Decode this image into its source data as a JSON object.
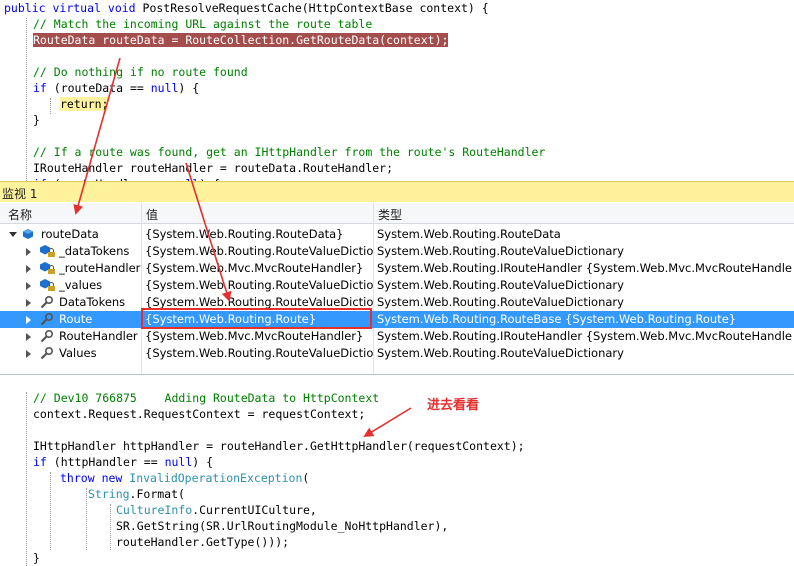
{
  "code_top": {
    "lines": [
      {
        "parts": [
          [
            "kw",
            "public"
          ],
          [
            "",
            " "
          ],
          [
            "kw",
            "virtual"
          ],
          [
            "",
            " "
          ],
          [
            "kw",
            "void"
          ],
          [
            "",
            " PostResolveRequestCache(HttpContextBase context) {"
          ]
        ]
      },
      {
        "parts": [
          [
            "cm",
            "// Match the incoming URL against the route table"
          ]
        ]
      },
      {
        "parts": [
          [
            "hl-red",
            "RouteData routeData = RouteCollection.GetRouteData(context);"
          ]
        ]
      },
      {
        "parts": [
          [
            "",
            ""
          ]
        ]
      },
      {
        "parts": [
          [
            "cm",
            "// Do nothing if no route found"
          ]
        ]
      },
      {
        "parts": [
          [
            "kw",
            "if"
          ],
          [
            "",
            " (routeData == "
          ],
          [
            "kw",
            "null"
          ],
          [
            "",
            ") {"
          ]
        ]
      },
      {
        "parts": [
          [
            "hl-yellow",
            "return;"
          ]
        ]
      },
      {
        "parts": [
          [
            "",
            "}"
          ]
        ]
      },
      {
        "parts": [
          [
            "",
            ""
          ]
        ]
      },
      {
        "parts": [
          [
            "cm",
            "// If a route was found, get an IHttpHandler from the route's RouteHandler"
          ]
        ]
      },
      {
        "parts": [
          [
            "",
            "IRouteHandler routeHandler = routeData.RouteHandler;"
          ]
        ]
      },
      {
        "parts": [
          [
            "kw",
            "if"
          ],
          [
            "",
            " (routeHandler == "
          ],
          [
            "kw",
            "null"
          ],
          [
            "",
            ") {"
          ]
        ]
      }
    ]
  },
  "watch": {
    "title": "监视 1",
    "headers": {
      "name": "名称",
      "value": "值",
      "type": "类型"
    },
    "rows": [
      {
        "name": "routeData",
        "value": "{System.Web.Routing.RouteData}",
        "type": "System.Web.Routing.RouteData",
        "icon": "object-icon",
        "expanded": true,
        "selected": false
      },
      {
        "name": "_dataTokens",
        "value": "{System.Web.Routing.RouteValueDictionary}",
        "type": "System.Web.Routing.RouteValueDictionary",
        "icon": "private-field-icon",
        "expanded": false,
        "selected": false
      },
      {
        "name": "_routeHandler",
        "value": "{System.Web.Mvc.MvcRouteHandler}",
        "type": "System.Web.Routing.IRouteHandler {System.Web.Mvc.MvcRouteHandler}",
        "icon": "private-field-icon",
        "expanded": false,
        "selected": false
      },
      {
        "name": "_values",
        "value": "{System.Web.Routing.RouteValueDictionary}",
        "type": "System.Web.Routing.RouteValueDictionary",
        "icon": "private-field-icon",
        "expanded": false,
        "selected": false
      },
      {
        "name": "DataTokens",
        "value": "{System.Web.Routing.RouteValueDictionary}",
        "type": "System.Web.Routing.RouteValueDictionary",
        "icon": "property-icon",
        "expanded": false,
        "selected": false
      },
      {
        "name": "Route",
        "value": "{System.Web.Routing.Route}",
        "type": "System.Web.Routing.RouteBase {System.Web.Routing.Route}",
        "icon": "property-icon",
        "expanded": false,
        "selected": true
      },
      {
        "name": "RouteHandler",
        "value": "{System.Web.Mvc.MvcRouteHandler}",
        "type": "System.Web.Routing.IRouteHandler {System.Web.Mvc.MvcRouteHandler}",
        "icon": "property-icon",
        "expanded": false,
        "selected": false
      },
      {
        "name": "Values",
        "value": "{System.Web.Routing.RouteValueDictionary}",
        "type": "System.Web.Routing.RouteValueDictionary",
        "icon": "property-icon",
        "expanded": false,
        "selected": false
      }
    ]
  },
  "code_bottom": {
    "lines": [
      {
        "parts": [
          [
            "cm",
            "// Dev10 766875    Adding RouteData to HttpContext"
          ]
        ]
      },
      {
        "parts": [
          [
            "",
            "context.Request.RequestContext = requestContext;"
          ]
        ]
      },
      {
        "parts": [
          [
            "",
            ""
          ]
        ]
      },
      {
        "parts": [
          [
            "",
            "IHttpHandler httpHandler = routeHandler.GetHttpHandler(requestContext);"
          ]
        ]
      },
      {
        "parts": [
          [
            "kw",
            "if"
          ],
          [
            "",
            " (httpHandler == "
          ],
          [
            "kw",
            "null"
          ],
          [
            "",
            ") {"
          ]
        ]
      },
      {
        "parts": [
          [
            "kw",
            "throw"
          ],
          [
            "",
            " "
          ],
          [
            "kw",
            "new"
          ],
          [
            "",
            " "
          ],
          [
            "ty",
            "InvalidOperationException"
          ],
          [
            "",
            "("
          ]
        ]
      },
      {
        "parts": [
          [
            "ty",
            "String"
          ],
          [
            "",
            ".Format("
          ]
        ]
      },
      {
        "parts": [
          [
            "ty",
            "CultureInfo"
          ],
          [
            "",
            ".CurrentUICulture,"
          ]
        ]
      },
      {
        "parts": [
          [
            "",
            "SR.GetString(SR.UrlRoutingModule_NoHttpHandler),"
          ]
        ]
      },
      {
        "parts": [
          [
            "",
            "routeHandler.GetType()));"
          ]
        ]
      },
      {
        "parts": [
          [
            "",
            "}"
          ]
        ]
      }
    ]
  },
  "annotation": {
    "text": "进去看看"
  },
  "colors": {
    "arrow": "#e53030",
    "selection": "#3399ff",
    "watch_title_bg": "#fff29d",
    "highlight_line": "#a34d4d"
  }
}
